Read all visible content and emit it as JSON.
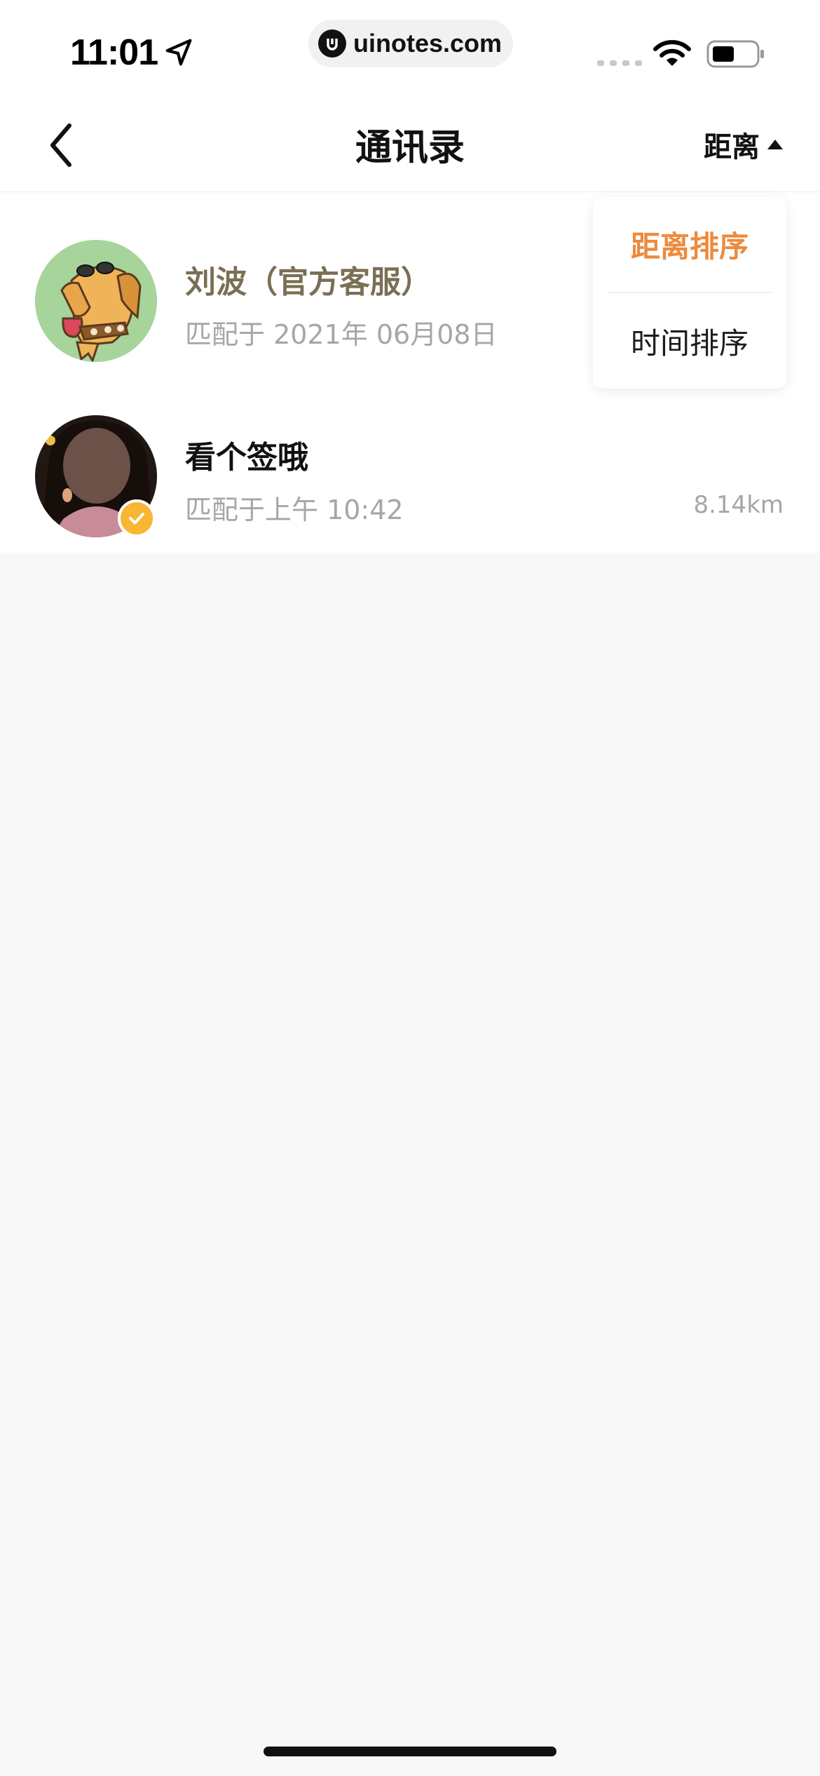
{
  "status_bar": {
    "time": "11:01",
    "url": "uinotes.com",
    "icons": [
      "location-arrow-icon",
      "signal-icon",
      "wifi-icon",
      "battery-icon"
    ]
  },
  "nav": {
    "title": "通讯录",
    "sort_label": "距离",
    "back_icon": "chevron-left-icon",
    "sort_icon": "triangle-up-icon"
  },
  "contacts": [
    {
      "name": "刘波（官方客服）",
      "subtitle": "匹配于 2021年 06月08日",
      "distance": "",
      "official": true
    },
    {
      "name": "看个签哦",
      "subtitle": "匹配于上午 10:42",
      "distance": "8.14km",
      "verified": true
    }
  ],
  "sort_menu": {
    "items": [
      {
        "label": "距离排序",
        "selected": true
      },
      {
        "label": "时间排序",
        "selected": false
      }
    ]
  },
  "colors": {
    "accent": "#ee8a3e",
    "official_name": "#7a6f54",
    "muted_text": "#a6a6a6",
    "badge": "#f7b733",
    "background": "#f8f8f8"
  }
}
